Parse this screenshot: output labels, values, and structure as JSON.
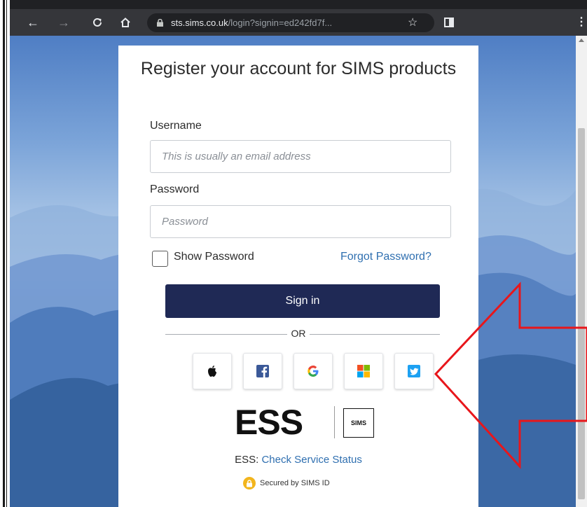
{
  "browser": {
    "url_host": "sts.sims.co.uk",
    "url_path": "/login?signin=ed242fd7f...",
    "icons": [
      "back-icon",
      "forward-icon",
      "reload-icon",
      "home-icon",
      "lock-icon",
      "star-icon",
      "extension-icon",
      "menu-icon"
    ]
  },
  "form": {
    "title": "Register your account for SIMS products",
    "username_label": "Username",
    "username_placeholder": "This is usually an email address",
    "password_label": "Password",
    "password_placeholder": "Password",
    "show_password_label": "Show Password",
    "forgot_password_link": "Forgot Password?",
    "signin_label": "Sign in",
    "or_label": "OR",
    "social_providers": [
      "Apple",
      "Facebook",
      "Google",
      "Microsoft",
      "Twitter"
    ]
  },
  "branding": {
    "ess_logo_text": "ESS",
    "sims_logo_text": "SIMS",
    "status_prefix": "ESS:",
    "status_link": "Check Service Status",
    "secured_text": "Secured by SIMS ID"
  },
  "colors": {
    "signin_button": "#1f2955",
    "link": "#2f6fb0",
    "annotation_arrow": "#e8161b"
  }
}
